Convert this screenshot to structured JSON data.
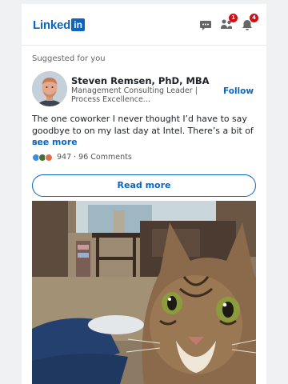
{
  "header": {
    "logo_text": "Linked",
    "logo_in": "in",
    "messaging_badge": "",
    "network_badge": "1",
    "notifications_badge": "4"
  },
  "feed": {
    "section_label": "Suggested for you",
    "author": {
      "name": "Steven Remsen, PhD, MBA",
      "headline": "Management Consulting Leader | Process Excellence...",
      "follow_label": "Follow"
    },
    "post": {
      "text": "The one coworker I never thought I’d have to say goodbye to on my last day at Intel. There’s a bit of a...",
      "see_more_label": "see more",
      "reaction_count": "947",
      "separator": "·",
      "comments": "96 Comments",
      "read_more_label": "Read more"
    }
  },
  "colors": {
    "brand": "#0a66c2",
    "badge": "#cc1016",
    "like": "#378fe9",
    "celebrate": "#44712e",
    "love": "#df704d"
  }
}
